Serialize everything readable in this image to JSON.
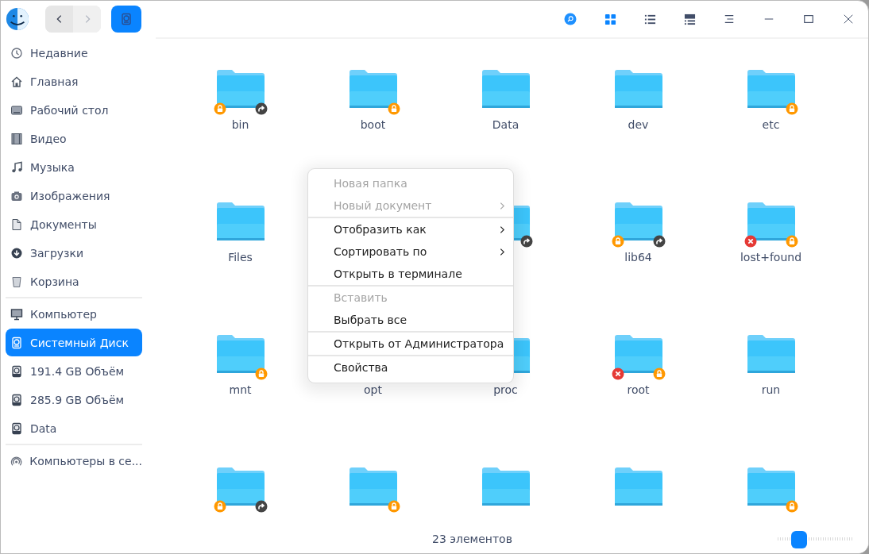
{
  "toolbar": {
    "back_enabled": true,
    "forward_enabled": false,
    "views": [
      {
        "kind": "icons",
        "selected": true
      },
      {
        "kind": "list",
        "selected": false
      },
      {
        "kind": "details",
        "selected": false
      }
    ]
  },
  "sidebar": {
    "groups": [
      [
        {
          "kind": "recent",
          "label": "Недавние",
          "selected": false
        },
        {
          "kind": "home",
          "label": "Главная",
          "selected": false
        },
        {
          "kind": "desktop",
          "label": "Рабочий стол",
          "selected": false
        },
        {
          "kind": "video",
          "label": "Видео",
          "selected": false
        },
        {
          "kind": "music",
          "label": "Музыка",
          "selected": false
        },
        {
          "kind": "pictures",
          "label": "Изображения",
          "selected": false
        },
        {
          "kind": "documents",
          "label": "Документы",
          "selected": false
        },
        {
          "kind": "downloads",
          "label": "Загрузки",
          "selected": false
        },
        {
          "kind": "trash",
          "label": "Корзина",
          "selected": false
        }
      ],
      [
        {
          "kind": "computer",
          "label": "Компьютер",
          "selected": false
        },
        {
          "kind": "disk",
          "label": "Системный Диск",
          "selected": true
        },
        {
          "kind": "drive",
          "label": "191.4 GB Объём",
          "selected": false
        },
        {
          "kind": "drive",
          "label": "285.9 GB Объём",
          "selected": false
        },
        {
          "kind": "drive",
          "label": "Data",
          "selected": false
        }
      ],
      [
        {
          "kind": "network",
          "label": "Компьютеры в се..."
        }
      ]
    ]
  },
  "files": [
    {
      "kind": "folder",
      "name": "bin",
      "locked": true,
      "symlink": true,
      "no_access": false
    },
    {
      "kind": "folder",
      "name": "boot",
      "locked": true,
      "symlink": false,
      "no_access": false
    },
    {
      "kind": "folder",
      "name": "Data",
      "locked": false,
      "symlink": false,
      "no_access": false
    },
    {
      "kind": "folder",
      "name": "dev",
      "locked": false,
      "symlink": false,
      "no_access": false
    },
    {
      "kind": "folder",
      "name": "etc",
      "locked": true,
      "symlink": false,
      "no_access": false
    },
    {
      "kind": "folder",
      "name": "Files",
      "locked": false,
      "symlink": false,
      "no_access": false
    },
    {
      "kind": "covered"
    },
    {
      "kind": "partial",
      "symlink": true
    },
    {
      "kind": "folder",
      "name": "lib64",
      "locked": true,
      "symlink": true,
      "no_access": false
    },
    {
      "kind": "folder",
      "name": "lost+found",
      "locked": true,
      "symlink": false,
      "no_access": true
    },
    {
      "kind": "folder",
      "name": "mnt",
      "locked": true,
      "symlink": false,
      "no_access": false
    },
    {
      "kind": "label-only",
      "name": "opt"
    },
    {
      "kind": "partial",
      "name": "proc",
      "symlink": false
    },
    {
      "kind": "folder",
      "name": "root",
      "locked": true,
      "symlink": false,
      "no_access": true
    },
    {
      "kind": "folder",
      "name": "run",
      "locked": false,
      "symlink": false,
      "no_access": false
    },
    {
      "kind": "folder",
      "locked": true,
      "symlink": true,
      "no_access": false
    },
    {
      "kind": "folder",
      "locked": true,
      "symlink": false,
      "no_access": false
    },
    {
      "kind": "folder",
      "locked": false,
      "symlink": false,
      "no_access": false
    },
    {
      "kind": "folder",
      "locked": false,
      "symlink": false,
      "no_access": false
    },
    {
      "kind": "folder",
      "locked": true,
      "symlink": false,
      "no_access": false
    }
  ],
  "context_menu": {
    "groups": [
      [
        {
          "label": "Новая папка",
          "disabled": true,
          "submenu": false
        },
        {
          "label": "Новый документ",
          "disabled": true,
          "submenu": true
        }
      ],
      [
        {
          "label": "Отобразить как",
          "disabled": false,
          "submenu": true
        },
        {
          "label": "Сортировать по",
          "disabled": false,
          "submenu": true
        },
        {
          "label": "Открыть в терминале",
          "disabled": false,
          "submenu": false
        }
      ],
      [
        {
          "label": "Вставить",
          "disabled": true,
          "submenu": false
        },
        {
          "label": "Выбрать все",
          "disabled": false,
          "submenu": false
        }
      ],
      [
        {
          "label": "Открыть от Администратора",
          "disabled": false,
          "submenu": false
        }
      ],
      [
        {
          "label": "Свойства",
          "disabled": false,
          "submenu": false
        }
      ]
    ]
  },
  "status_bar": {
    "count": "23 элементов",
    "zoom": {
      "level": 0.23
    }
  }
}
